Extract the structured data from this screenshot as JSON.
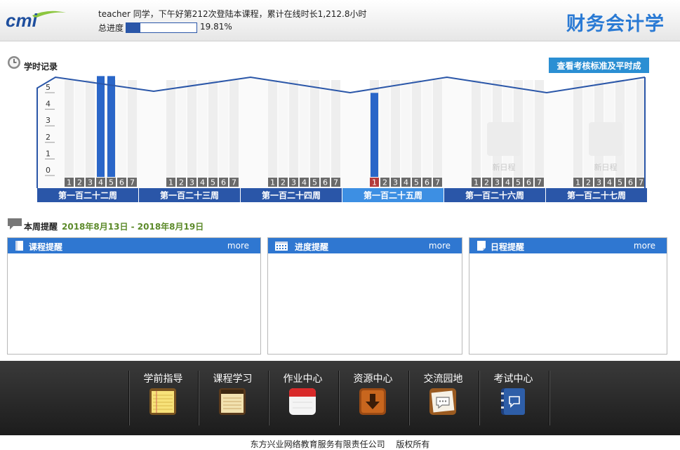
{
  "header": {
    "greeting": "teacher 同学，下午好第212次登陆本课程，累计在线时长1,212.8小时",
    "progress_label": "总进度",
    "progress_value": "19.81%",
    "progress_fraction": 0.1981,
    "course_title": "财务会计学"
  },
  "study_record": {
    "title": "学时记录",
    "standard_button": "查看考核标准及平时成绩",
    "new_schedule_label": "新日程"
  },
  "chart_data": {
    "type": "bar",
    "ylim": [
      0,
      5
    ],
    "yticks": [
      "5",
      "4",
      "3",
      "2",
      "1",
      "0"
    ],
    "day_labels": [
      "1",
      "2",
      "3",
      "4",
      "5",
      "6",
      "7"
    ],
    "weeks": [
      {
        "label": "第一百二十二周",
        "values": [
          0,
          0,
          0,
          5.4,
          5.4,
          0,
          0
        ],
        "current": false,
        "future": false
      },
      {
        "label": "第一百二十三周",
        "values": [
          0,
          0,
          0,
          0,
          0,
          0,
          0
        ],
        "current": false,
        "future": false
      },
      {
        "label": "第一百二十四周",
        "values": [
          0,
          0,
          0,
          0,
          0,
          0,
          0
        ],
        "current": false,
        "future": false
      },
      {
        "label": "第一百二十五周",
        "values": [
          4.5,
          0,
          0,
          0,
          0,
          0,
          0
        ],
        "current": true,
        "future": false,
        "today": 1
      },
      {
        "label": "第一百二十六周",
        "values": [
          0,
          0,
          0,
          0,
          0,
          0,
          0
        ],
        "current": false,
        "future": true
      },
      {
        "label": "第一百二十七周",
        "values": [
          0,
          0,
          0,
          0,
          0,
          0,
          0
        ],
        "current": false,
        "future": true
      }
    ],
    "colors": {
      "bar": "#2a66c8",
      "today": "#b43a3a",
      "band": "#2a56a8",
      "current_band": "#3d8fe3"
    }
  },
  "weekly": {
    "title": "本周提醒",
    "date_range": "2018年8月13日 - 2018年8月19日",
    "panels": [
      {
        "title": "课程提醒",
        "more": "more"
      },
      {
        "title": "进度提醒",
        "more": "more"
      },
      {
        "title": "日程提醒",
        "more": "more"
      }
    ]
  },
  "nav": {
    "items": [
      {
        "label": "学前指导",
        "icon": "notepad-icon"
      },
      {
        "label": "课程学习",
        "icon": "notebook-icon"
      },
      {
        "label": "作业中心",
        "icon": "calendar-icon"
      },
      {
        "label": "资源中心",
        "icon": "download-icon"
      },
      {
        "label": "交流园地",
        "icon": "chat-board-icon"
      },
      {
        "label": "考试中心",
        "icon": "exam-book-icon"
      }
    ]
  },
  "footer": {
    "copyright": "东方兴业网络教育服务有限责任公司　 版权所有"
  }
}
